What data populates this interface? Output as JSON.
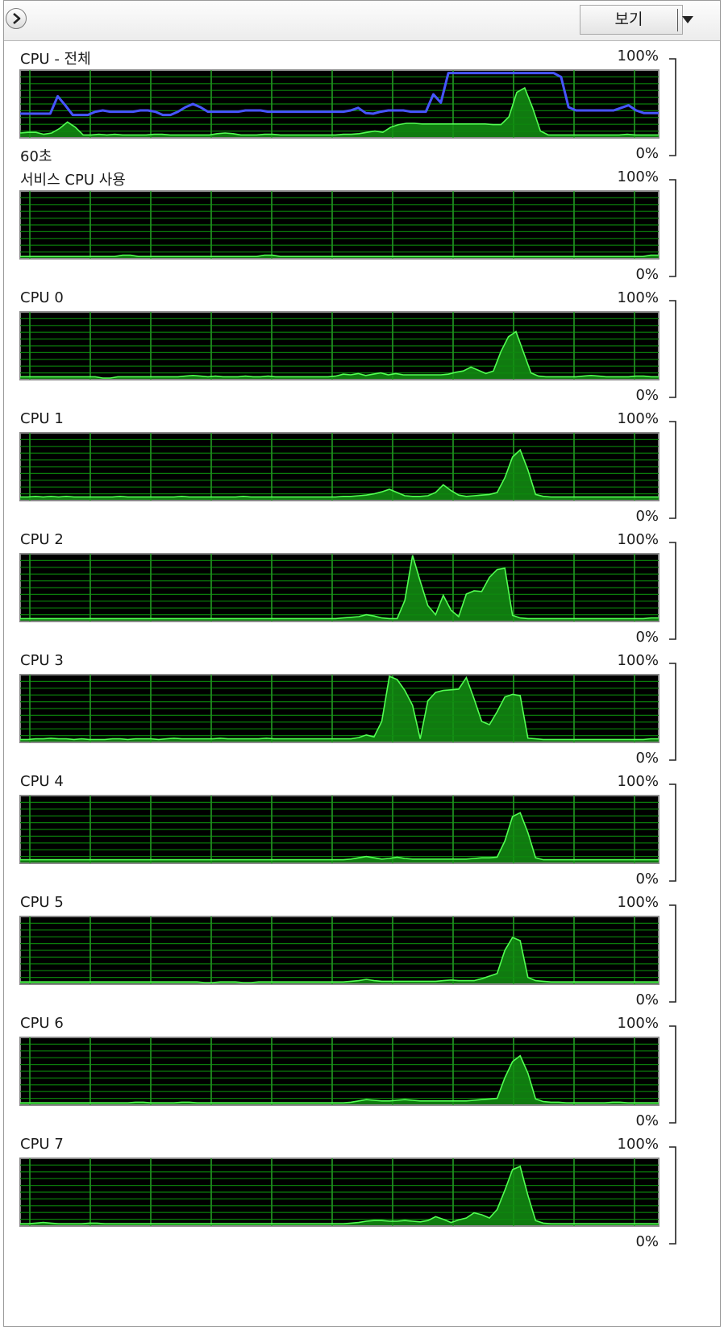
{
  "toolbar": {
    "view_label": "보기",
    "toggle_icon": "chevron-right-icon",
    "dropdown_icon": "caret-down-icon"
  },
  "scale_max_label": "100%",
  "scale_min_label": "0%",
  "time_window_label": "60초",
  "colors": {
    "graph_bg": "#000000",
    "grid": "#0c7d0c",
    "grid_vertical": "#2ab02a",
    "fill": "#139113",
    "line": "#52ff52",
    "overall_line": "#4655ff"
  },
  "graphs": [
    {
      "title": "CPU - 전체",
      "show_time_label": true,
      "utilization": [
        5,
        6,
        6,
        3,
        5,
        12,
        22,
        14,
        2,
        2,
        3,
        2,
        3,
        2,
        2,
        2,
        2,
        3,
        3,
        2,
        2,
        2,
        2,
        2,
        2,
        4,
        5,
        4,
        2,
        2,
        2,
        3,
        3,
        2,
        2,
        2,
        2,
        2,
        2,
        2,
        2,
        3,
        3,
        4,
        6,
        8,
        6,
        14,
        18,
        20,
        20,
        19,
        19,
        19,
        19,
        19,
        19,
        19,
        19,
        19,
        18,
        18,
        30,
        68,
        75,
        44,
        8,
        2,
        2,
        2,
        2,
        2,
        2,
        2,
        2,
        2,
        2,
        3,
        2,
        2,
        2,
        2
      ],
      "line_series": [
        35,
        35,
        35,
        35,
        35,
        35,
        62,
        48,
        33,
        33,
        33,
        38,
        40,
        38,
        38,
        38,
        38,
        40,
        40,
        38,
        33,
        33,
        38,
        45,
        50,
        45,
        38,
        38,
        38,
        38,
        38,
        40,
        40,
        40,
        38,
        38,
        38,
        38,
        38,
        38,
        38,
        38,
        38,
        38,
        38,
        40,
        44,
        36,
        35,
        38,
        40,
        40,
        40,
        38,
        38,
        38,
        38,
        38,
        38,
        65,
        52,
        98,
        98,
        98,
        98,
        98,
        98,
        98,
        98,
        98,
        98,
        98,
        98,
        98,
        98,
        98,
        98,
        92,
        45,
        40,
        40,
        40,
        40
      ],
      "overall_line_values": [
        35,
        35,
        35,
        35,
        35,
        62,
        48,
        33,
        33,
        33,
        38,
        40,
        38,
        38,
        38,
        38,
        40,
        40,
        38,
        33,
        33,
        38,
        45,
        50,
        45,
        38,
        38,
        38,
        38,
        38,
        40,
        40,
        40,
        38,
        38,
        38,
        38,
        38,
        38,
        38,
        38,
        38,
        38,
        38,
        40,
        44,
        36,
        35,
        38,
        40,
        40,
        40,
        38,
        38,
        38,
        65,
        52,
        98,
        98,
        98,
        98,
        98,
        98,
        98,
        98,
        98,
        98,
        98,
        98,
        98,
        98,
        98,
        92,
        45,
        40,
        40,
        40,
        40,
        40,
        40,
        44,
        48,
        40,
        36,
        36,
        36
      ]
    },
    {
      "title": "서비스 CPU 사용",
      "show_time_label": false,
      "utilization": [
        1,
        1,
        1,
        1,
        1,
        1,
        1,
        1,
        1,
        1,
        1,
        1,
        1,
        3,
        3,
        1,
        1,
        1,
        1,
        1,
        1,
        1,
        1,
        1,
        1,
        1,
        1,
        1,
        1,
        1,
        1,
        3,
        3,
        1,
        1,
        1,
        1,
        1,
        1,
        1,
        1,
        1,
        1,
        1,
        1,
        1,
        1,
        1,
        1,
        1,
        1,
        1,
        1,
        1,
        1,
        1,
        1,
        1,
        1,
        1,
        1,
        1,
        1,
        1,
        1,
        1,
        1,
        1,
        1,
        1,
        1,
        1,
        1,
        1,
        1,
        1,
        1,
        1,
        1,
        1,
        3,
        3
      ]
    },
    {
      "title": "CPU 0",
      "show_time_label": false,
      "utilization": [
        2,
        2,
        2,
        2,
        2,
        2,
        2,
        2,
        2,
        2,
        2,
        0,
        0,
        2,
        2,
        2,
        2,
        2,
        2,
        2,
        2,
        2,
        3,
        4,
        3,
        2,
        3,
        2,
        2,
        2,
        3,
        2,
        2,
        3,
        2,
        2,
        2,
        2,
        2,
        2,
        2,
        2,
        3,
        6,
        5,
        7,
        4,
        6,
        8,
        5,
        7,
        5,
        5,
        5,
        5,
        5,
        5,
        6,
        9,
        11,
        17,
        12,
        7,
        11,
        41,
        64,
        72,
        40,
        8,
        3,
        2,
        2,
        2,
        2,
        2,
        3,
        4,
        3,
        2,
        2,
        2,
        2,
        3,
        3,
        2,
        2
      ]
    },
    {
      "title": "CPU 1",
      "show_time_label": false,
      "utilization": [
        3,
        3,
        4,
        3,
        4,
        3,
        4,
        3,
        3,
        3,
        3,
        3,
        3,
        4,
        3,
        3,
        3,
        3,
        3,
        3,
        3,
        4,
        3,
        3,
        3,
        3,
        3,
        3,
        3,
        4,
        3,
        3,
        3,
        3,
        3,
        3,
        3,
        3,
        3,
        3,
        3,
        3,
        4,
        4,
        5,
        6,
        8,
        11,
        15,
        10,
        5,
        4,
        4,
        5,
        10,
        22,
        13,
        6,
        4,
        5,
        6,
        7,
        10,
        33,
        65,
        76,
        45,
        7,
        4,
        3,
        3,
        3,
        3,
        3,
        3,
        3,
        3,
        3,
        3,
        3,
        3,
        3,
        3,
        3
      ]
    },
    {
      "title": "CPU 2",
      "show_time_label": false,
      "utilization": [
        2,
        2,
        2,
        2,
        2,
        2,
        2,
        2,
        2,
        2,
        2,
        2,
        2,
        2,
        2,
        2,
        2,
        2,
        2,
        2,
        2,
        2,
        2,
        2,
        2,
        2,
        2,
        2,
        2,
        2,
        2,
        2,
        2,
        2,
        2,
        2,
        2,
        2,
        2,
        2,
        2,
        2,
        3,
        4,
        5,
        8,
        6,
        3,
        2,
        2,
        30,
        100,
        60,
        22,
        8,
        38,
        15,
        5,
        40,
        45,
        44,
        66,
        78,
        80,
        7,
        3,
        2,
        2,
        2,
        2,
        2,
        2,
        2,
        2,
        2,
        2,
        2,
        2,
        2,
        2,
        2,
        2,
        3,
        3
      ]
    },
    {
      "title": "CPU 3",
      "show_time_label": false,
      "utilization": [
        2,
        2,
        3,
        3,
        4,
        3,
        3,
        2,
        3,
        2,
        2,
        2,
        3,
        3,
        2,
        3,
        3,
        3,
        2,
        3,
        4,
        3,
        3,
        3,
        3,
        3,
        4,
        3,
        3,
        3,
        3,
        3,
        4,
        3,
        3,
        3,
        3,
        3,
        3,
        3,
        3,
        3,
        3,
        3,
        5,
        9,
        6,
        30,
        100,
        95,
        78,
        55,
        3,
        62,
        75,
        78,
        79,
        80,
        98,
        65,
        30,
        25,
        45,
        68,
        72,
        70,
        4,
        3,
        2,
        2,
        2,
        2,
        2,
        2,
        2,
        2,
        2,
        2,
        2,
        2,
        2,
        2,
        3,
        3
      ]
    },
    {
      "title": "CPU 4",
      "show_time_label": false,
      "utilization": [
        3,
        3,
        3,
        3,
        3,
        3,
        3,
        3,
        3,
        3,
        3,
        3,
        3,
        3,
        3,
        3,
        3,
        3,
        3,
        3,
        3,
        3,
        3,
        3,
        3,
        3,
        3,
        3,
        3,
        3,
        3,
        3,
        3,
        3,
        3,
        3,
        3,
        3,
        3,
        3,
        3,
        3,
        3,
        4,
        6,
        8,
        6,
        4,
        5,
        7,
        5,
        4,
        4,
        4,
        4,
        4,
        4,
        4,
        4,
        5,
        6,
        6,
        7,
        32,
        70,
        76,
        45,
        6,
        3,
        3,
        3,
        3,
        3,
        3,
        3,
        3,
        3,
        3,
        3,
        3,
        3,
        3,
        3,
        3
      ]
    },
    {
      "title": "CPU 5",
      "show_time_label": false,
      "utilization": [
        1,
        1,
        1,
        1,
        1,
        1,
        1,
        1,
        1,
        1,
        1,
        1,
        1,
        1,
        1,
        1,
        1,
        1,
        1,
        1,
        1,
        1,
        1,
        1,
        0,
        0,
        1,
        1,
        1,
        0,
        0,
        1,
        1,
        1,
        1,
        1,
        1,
        1,
        1,
        1,
        1,
        1,
        1,
        2,
        3,
        5,
        3,
        2,
        2,
        2,
        2,
        2,
        2,
        2,
        2,
        3,
        4,
        3,
        3,
        3,
        6,
        10,
        14,
        50,
        70,
        65,
        8,
        3,
        2,
        1,
        1,
        1,
        1,
        1,
        1,
        1,
        1,
        1,
        1,
        1,
        1,
        1,
        1,
        1
      ]
    },
    {
      "title": "CPU 6",
      "show_time_label": false,
      "utilization": [
        1,
        1,
        1,
        1,
        1,
        1,
        1,
        1,
        1,
        1,
        1,
        1,
        1,
        1,
        1,
        2,
        2,
        1,
        1,
        1,
        1,
        2,
        2,
        1,
        1,
        1,
        1,
        1,
        1,
        1,
        1,
        1,
        1,
        1,
        1,
        1,
        1,
        1,
        1,
        1,
        1,
        1,
        1,
        2,
        4,
        6,
        5,
        4,
        4,
        5,
        6,
        5,
        4,
        4,
        4,
        4,
        4,
        4,
        4,
        5,
        6,
        7,
        8,
        40,
        65,
        74,
        47,
        7,
        3,
        2,
        2,
        1,
        1,
        1,
        1,
        1,
        1,
        2,
        2,
        1,
        1,
        1,
        1,
        1
      ]
    },
    {
      "title": "CPU 7",
      "show_time_label": false,
      "utilization": [
        1,
        1,
        2,
        3,
        2,
        1,
        1,
        1,
        1,
        2,
        2,
        1,
        1,
        1,
        1,
        1,
        1,
        1,
        1,
        1,
        1,
        1,
        1,
        1,
        1,
        1,
        1,
        1,
        1,
        1,
        1,
        1,
        1,
        1,
        1,
        1,
        1,
        1,
        1,
        1,
        1,
        1,
        1,
        2,
        3,
        5,
        6,
        6,
        5,
        5,
        6,
        5,
        4,
        6,
        12,
        8,
        3,
        7,
        10,
        18,
        15,
        10,
        23,
        53,
        85,
        90,
        45,
        6,
        2,
        1,
        1,
        1,
        1,
        1,
        1,
        1,
        1,
        1,
        1,
        1,
        1,
        1,
        1,
        1
      ]
    }
  ]
}
